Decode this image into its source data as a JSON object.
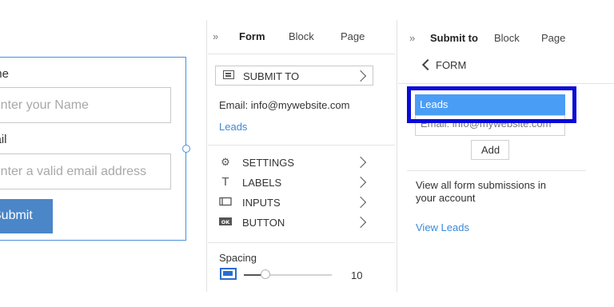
{
  "form_preview": {
    "name_label": "Name",
    "name_placeholder": "Enter your Name",
    "email_label": "Email",
    "email_placeholder": "Enter a valid email address",
    "submit_label": "Submit"
  },
  "middle_panel": {
    "expand_icon": "double-chevron-right-icon",
    "tabs": [
      "Form",
      "Block",
      "Page"
    ],
    "active_tab": "Form",
    "submit_to_label": "SUBMIT TO",
    "email_line": "Email: info@mywebsite.com",
    "leads_link": "Leads",
    "menu": [
      {
        "label": "SETTINGS",
        "icon": "gear-icon"
      },
      {
        "label": "LABELS",
        "icon": "text-icon"
      },
      {
        "label": "INPUTS",
        "icon": "input-icon"
      },
      {
        "label": "BUTTON",
        "icon": "ok-button-icon"
      }
    ],
    "spacing_label": "Spacing",
    "spacing_value": "10"
  },
  "right_panel": {
    "expand_icon": "double-chevron-right-icon",
    "tabs": [
      "Submit to",
      "Block",
      "Page"
    ],
    "active_tab": "Submit to",
    "back_label": "FORM",
    "selected_option": "Leads",
    "email_option": "Email: info@mywebsite.com",
    "add_label": "Add",
    "description": "View all form submissions in your account",
    "description_line1": "View all form submissions in",
    "description_line2": "your account",
    "view_leads_link": "View Leads"
  },
  "colors": {
    "accent_blue": "#4a86c8",
    "link_blue": "#3b8ad9",
    "highlight_border": "#0a0ad8",
    "selected_fill": "#4a9df5"
  }
}
